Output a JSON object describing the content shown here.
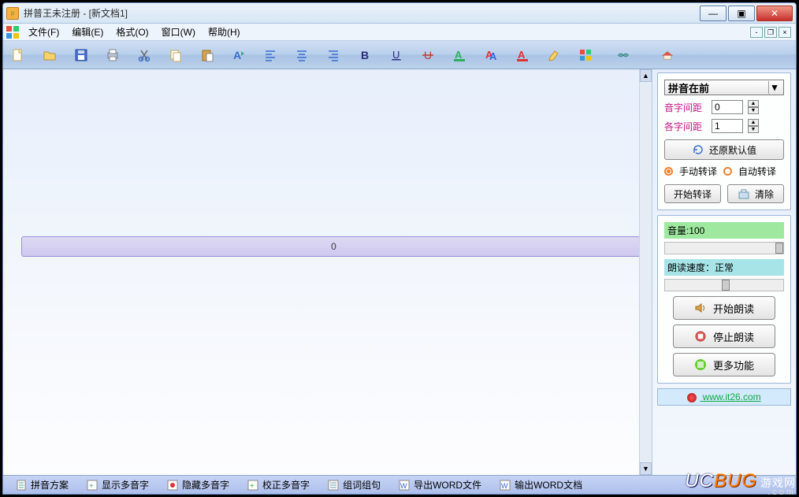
{
  "title": "拼普王未注册  - [新文档1]",
  "menus": [
    "文件(F)",
    "编辑(E)",
    "格式(O)",
    "窗口(W)",
    "帮助(H)"
  ],
  "toolbar_icons": [
    "new",
    "open",
    "save",
    "print",
    "cut",
    "copy",
    "paste",
    "undo",
    "align-left",
    "align-center",
    "align-right",
    "bold",
    "underline",
    "strike",
    "font-color-1",
    "font-color-2",
    "font-color-3",
    "highlight",
    "grid",
    "handshake",
    "home"
  ],
  "editor": {
    "content": "0"
  },
  "side": {
    "dropdown": "拼音在前",
    "spacing": {
      "label1": "音字间距",
      "label2": "各字间距",
      "val1": "0",
      "val2": "1"
    },
    "restore_btn": "还原默认值",
    "radio1": "手动转译",
    "radio2": "自动转译",
    "start_translate": "开始转译",
    "clear_btn": "清除",
    "volume_label": "音量:100",
    "speed_label": "朗读速度：正常",
    "start_read": "开始朗读",
    "stop_read": "停止朗读",
    "more_func": "更多功能",
    "link": "www.it26.com"
  },
  "statusbar": [
    "拼音方案",
    "显示多音字",
    "隐藏多音字",
    "校正多音字",
    "组词组句",
    "导出WORD文件",
    "输出WORD文档"
  ],
  "watermark": {
    "a": "UC",
    "b": "BUG",
    "c": "游戏网",
    "d": ".com"
  }
}
